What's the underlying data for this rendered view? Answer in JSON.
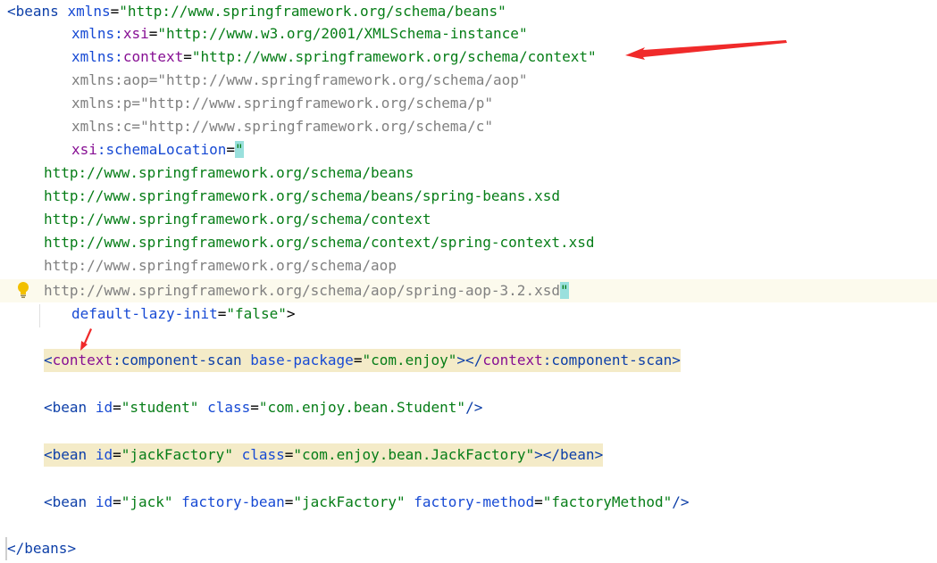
{
  "lines": {
    "l1": {
      "lt": "<",
      "tag": "beans",
      "attr": "xmlns",
      "eq": "=",
      "val": "\"http://www.springframework.org/schema/beans\""
    },
    "l2": {
      "pfx": "xmlns",
      "colon": ":",
      "ns": "xsi",
      "eq": "=",
      "val": "\"http://www.w3.org/2001/XMLSchema-instance\""
    },
    "l3": {
      "pfx": "xmlns",
      "colon": ":",
      "ns": "context",
      "eq": "=",
      "val": "\"http://www.springframework.org/schema/context\""
    },
    "l4": {
      "text": "xmlns:aop=\"http://www.springframework.org/schema/aop\""
    },
    "l5": {
      "text": "xmlns:p=\"http://www.springframework.org/schema/p\""
    },
    "l6": {
      "text": "xmlns:c=\"http://www.springframework.org/schema/c\""
    },
    "l7": {
      "ns": "xsi",
      "colon": ":",
      "attr": "schemaLocation",
      "eq": "=",
      "quote": "\""
    },
    "l8": {
      "text": "http://www.springframework.org/schema/beans"
    },
    "l9": {
      "text": "http://www.springframework.org/schema/beans/spring-beans.xsd"
    },
    "l10": {
      "text": "http://www.springframework.org/schema/context"
    },
    "l11": {
      "text": "http://www.springframework.org/schema/context/spring-context.xsd"
    },
    "l12": {
      "text": "http://www.springframework.org/schema/aop"
    },
    "l13": {
      "text": "http://www.springframework.org/schema/aop/spring-aop-3.2.xsd",
      "quote": "\""
    },
    "l14": {
      "attr": "default-lazy-init",
      "eq": "=",
      "val": "\"false\"",
      "gt": ">"
    },
    "l15": {
      "lt": "<",
      "ns": "context",
      "colon": ":",
      "tag": "component-scan",
      "attr": "base-package",
      "eq": "=",
      "val": "\"com.enjoy\"",
      "mid": "></",
      "ns2": "context",
      "colon2": ":",
      "tag2": "component-scan",
      "gt": ">"
    },
    "l16": {
      "lt": "<",
      "tag": "bean",
      "a1": "id",
      "eq1": "=",
      "v1": "\"student\"",
      "a2": "class",
      "eq2": "=",
      "v2": "\"com.enjoy.bean.Student\"",
      "end": "/>"
    },
    "l17": {
      "lt": "<",
      "tag": "bean",
      "a1": "id",
      "eq1": "=",
      "v1": "\"jackFactory\"",
      "a2": "class",
      "eq2": "=",
      "v2": "\"com.enjoy.bean.JackFactory\"",
      "mid": "></",
      "tag2": "bean",
      "gt": ">"
    },
    "l18": {
      "lt": "<",
      "tag": "bean",
      "a1": "id",
      "eq1": "=",
      "v1": "\"jack\"",
      "a2": "factory-bean",
      "eq2": "=",
      "v2": "\"jackFactory\"",
      "a3": "factory-method",
      "eq3": "=",
      "v3": "\"factoryMethod\"",
      "end": "/>"
    },
    "l19": {
      "lt": "</",
      "tag": "beans",
      "gt": ">"
    }
  },
  "icons": {
    "bulb": "lightbulb-icon",
    "arrows": "red-annotation-arrow"
  },
  "colors": {
    "tag": "#0d3fa8",
    "attr": "#174ad4",
    "namespace": "#871094",
    "string": "#067d17",
    "inactive": "#808080",
    "highlight": "#f4ebc8",
    "arrow": "#f02a2a"
  }
}
